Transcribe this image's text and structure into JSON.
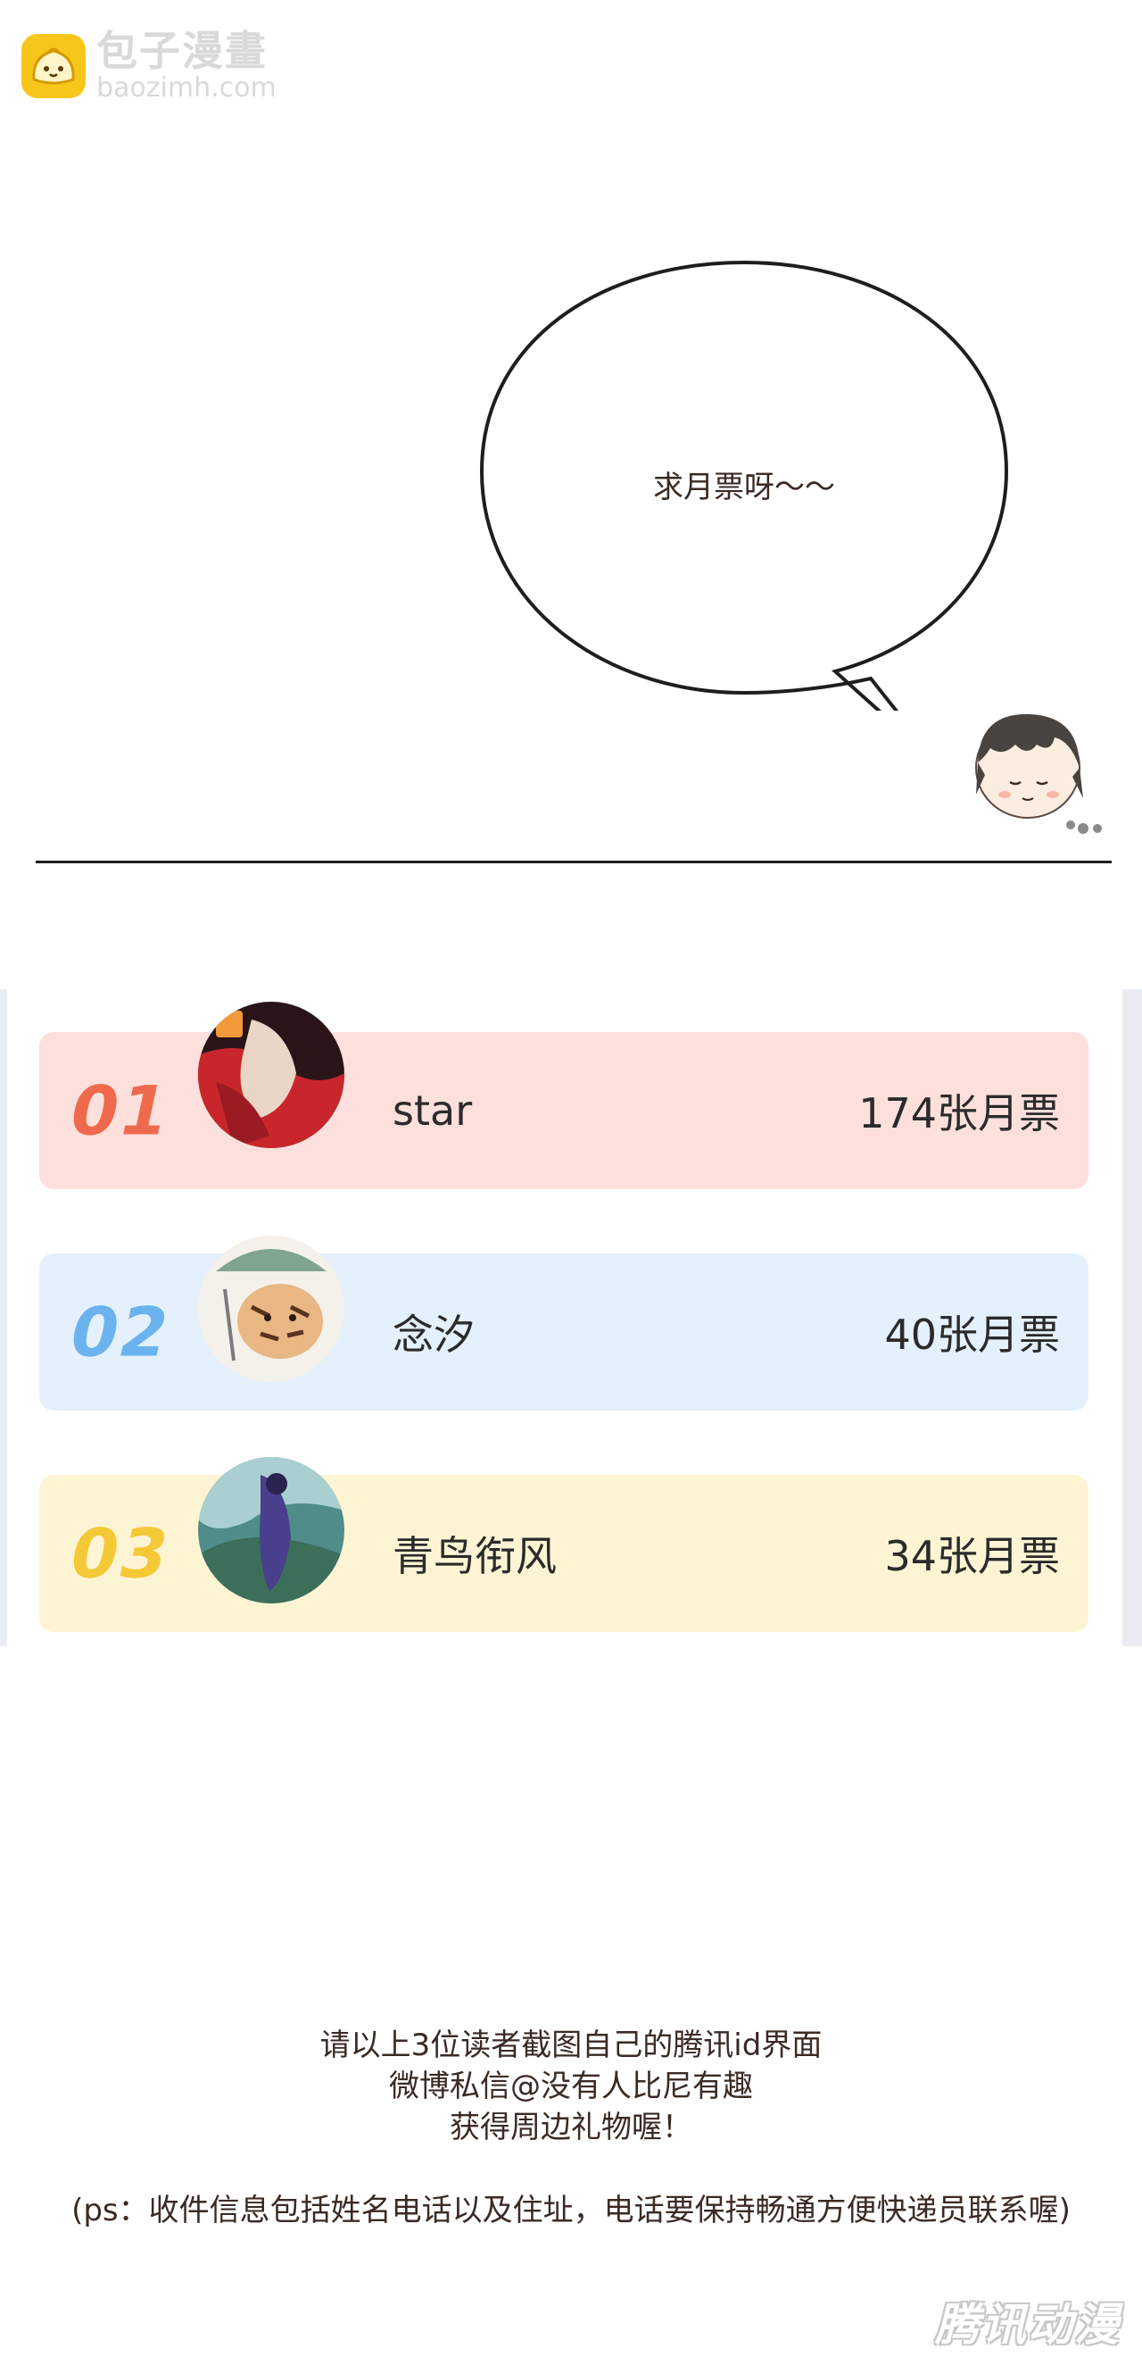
{
  "watermark": {
    "title": "包子漫畫",
    "subtitle": "baozimh.com",
    "logo_icon": "bun-face-icon",
    "logo_color": "#f8c61b"
  },
  "speech_bubble": {
    "text": "求月票呀～～"
  },
  "ranking": [
    {
      "rank": "01",
      "name": "star",
      "votes": "174张月票",
      "bg_color": "#fde0dc",
      "num_color": "#ef6a4d"
    },
    {
      "rank": "02",
      "name": "念汐",
      "votes": "40张月票",
      "bg_color": "#e4f0fc",
      "num_color": "#6bb3ee"
    },
    {
      "rank": "03",
      "name": "青鸟衔风",
      "votes": "34张月票",
      "bg_color": "#fdf4d4",
      "num_color": "#f5c936"
    }
  ],
  "footer": {
    "line1": "请以上3位读者截图自己的腾讯id界面",
    "line2": "微博私信@没有人比尼有趣",
    "line3": "获得周边礼物喔！",
    "ps": "(ps：收件信息包括姓名电话以及住址，电话要保持畅通方便快递员联系喔)"
  },
  "bottom_watermark": "腾讯动漫"
}
